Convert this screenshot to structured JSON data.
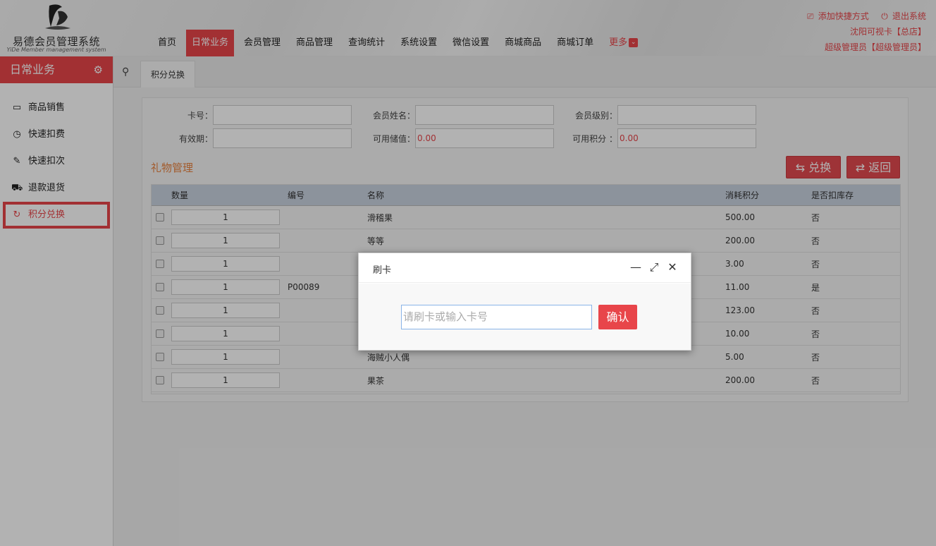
{
  "header": {
    "logo_name": "易德会员管理系统",
    "logo_sub": "YiDe Member management system",
    "nav": [
      "首页",
      "日常业务",
      "会员管理",
      "商品管理",
      "查询统计",
      "系统设置",
      "微信设置",
      "商城商品",
      "商城订单",
      "更多"
    ],
    "active_nav_index": 1,
    "add_shortcut": "添加快捷方式",
    "logout": "退出系统",
    "store": "沈阳可视卡【总店】",
    "user": "超级管理员【超级管理员】"
  },
  "sidebar": {
    "title": "日常业务",
    "items": [
      {
        "label": "商品销售",
        "icon": "monitor-icon"
      },
      {
        "label": "快速扣费",
        "icon": "stopwatch-icon"
      },
      {
        "label": "快速扣次",
        "icon": "edit-icon"
      },
      {
        "label": "退款退货",
        "icon": "cart-icon"
      },
      {
        "label": "积分兑换",
        "icon": "refresh-icon"
      }
    ],
    "active_index": 4
  },
  "tab": {
    "label": "积分兑换"
  },
  "form": {
    "card_no_label": "卡号：",
    "member_name_label": "会员姓名：",
    "member_level_label": "会员级别：",
    "expiry_label": "有效期：",
    "balance_label": "可用储值：",
    "points_label": "可用积分 ：",
    "card_no": "",
    "member_name": "",
    "member_level": "",
    "expiry": "",
    "balance": "0.00",
    "points": "0.00"
  },
  "gift": {
    "title": "礼物管理",
    "exchange_button": "兑换",
    "back_button": "返回",
    "columns": [
      "数量",
      "编号",
      "名称",
      "消耗积分",
      "是否扣库存"
    ],
    "rows": [
      {
        "qty": "1",
        "code": "",
        "name": "滑稽果",
        "points": "500.00",
        "deduct": "否"
      },
      {
        "qty": "1",
        "code": "",
        "name": "等等",
        "points": "200.00",
        "deduct": "否"
      },
      {
        "qty": "1",
        "code": "",
        "name": "",
        "points": "3.00",
        "deduct": "否"
      },
      {
        "qty": "1",
        "code": "P00089",
        "name": "",
        "points": "11.00",
        "deduct": "是"
      },
      {
        "qty": "1",
        "code": "",
        "name": "",
        "points": "123.00",
        "deduct": "否"
      },
      {
        "qty": "1",
        "code": "",
        "name": "",
        "points": "10.00",
        "deduct": "否"
      },
      {
        "qty": "1",
        "code": "",
        "name": "海贼小人偶",
        "points": "5.00",
        "deduct": "否"
      },
      {
        "qty": "1",
        "code": "",
        "name": "果茶",
        "points": "200.00",
        "deduct": "否"
      }
    ]
  },
  "dialog": {
    "title": "刷卡",
    "input_placeholder": "请刷卡或输入卡号",
    "confirm": "确认"
  },
  "colors": {
    "accent": "#e8454a",
    "title_orange": "#e8823e",
    "table_head": "#c9d3e0"
  }
}
